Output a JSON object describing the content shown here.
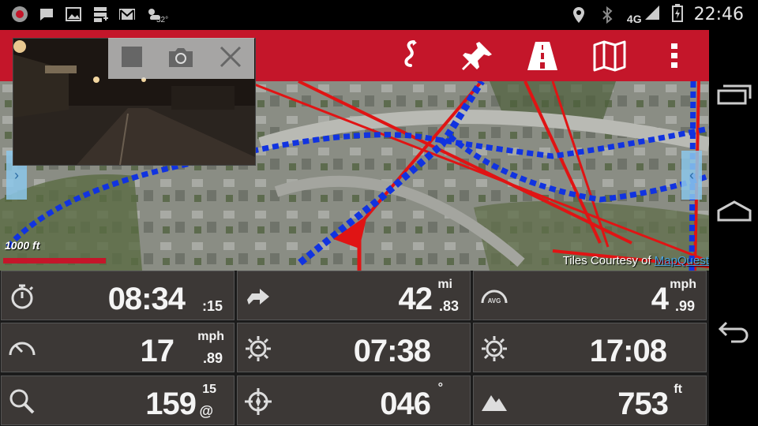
{
  "status_bar": {
    "time": "22:46",
    "network": "4G",
    "weather_temp": "32°",
    "icons": [
      "record-icon",
      "chat-icon",
      "image-icon",
      "sd-card-icon",
      "gmail-icon",
      "weather-icon",
      "location-icon",
      "bluetooth-icon",
      "signal-icon",
      "battery-icon"
    ]
  },
  "toolbar": {
    "buttons": [
      "route-icon",
      "pin-icon",
      "road-icon",
      "map-icon",
      "overflow-menu-icon"
    ],
    "accent": "#c4162a"
  },
  "camera": {
    "controls": [
      "stop-icon",
      "camera-icon",
      "close-icon"
    ]
  },
  "map": {
    "scale_label": "1000 ft",
    "credit_prefix": "Tiles Courtesy of ",
    "credit_link": "MapQuest",
    "left_tab": "›",
    "right_tab": "‹"
  },
  "dashboard": {
    "timer": {
      "value": "08:34",
      "sub": ":15"
    },
    "distance": {
      "value": "42",
      "unit": "mi",
      "sub": ".83"
    },
    "avg_speed": {
      "value": "4",
      "unit": "mph",
      "sub": ".99",
      "badge": "AVG"
    },
    "speed": {
      "value": "17",
      "unit": "mph",
      "sub": ".89"
    },
    "sunrise": {
      "value": "07:38"
    },
    "sunset": {
      "value": "17:08"
    },
    "gps": {
      "value": "159",
      "top": "15",
      "sub": "@"
    },
    "heading": {
      "value": "046",
      "unit": "°"
    },
    "altitude": {
      "value": "753",
      "unit": "ft"
    }
  }
}
